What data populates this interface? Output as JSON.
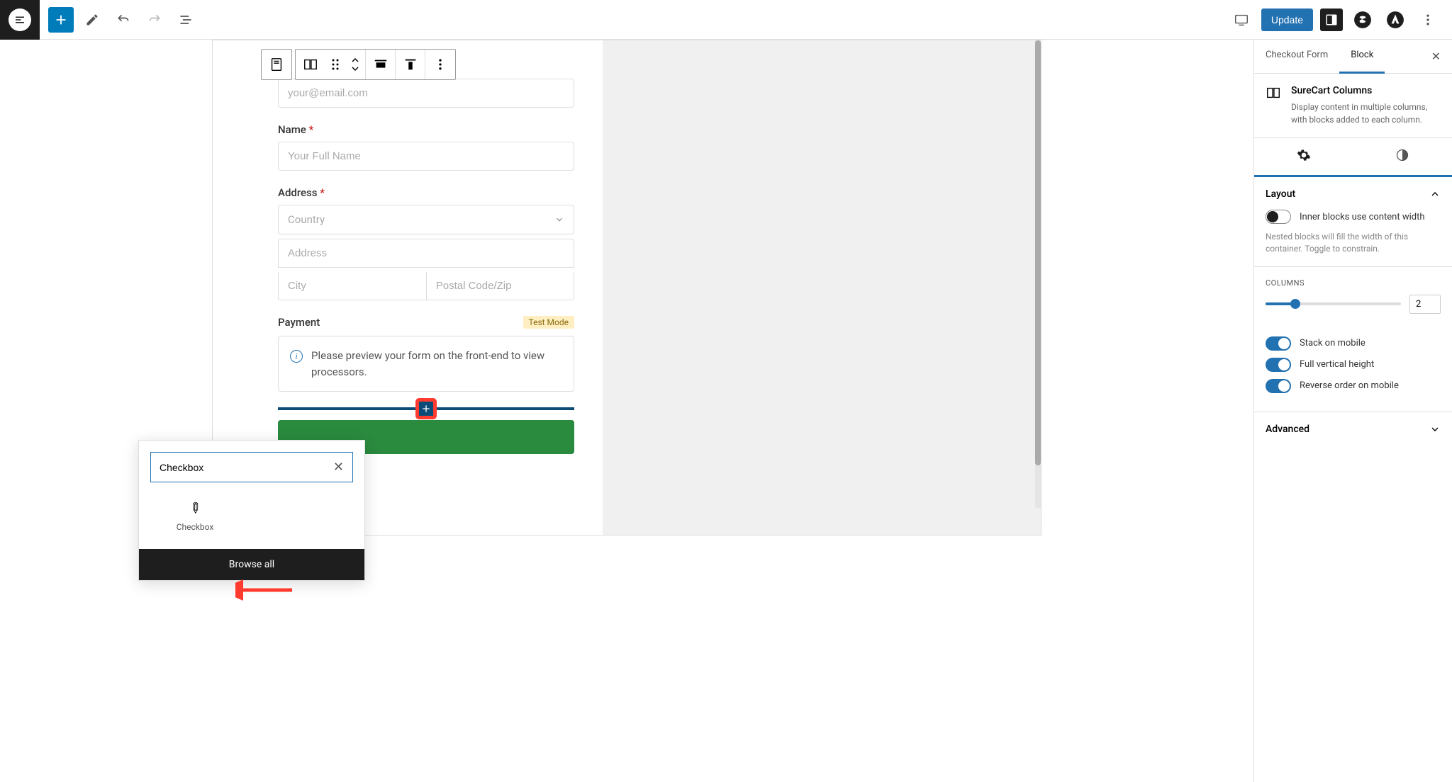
{
  "topbar": {
    "update_label": "Update"
  },
  "form": {
    "email_placeholder": "your@email.com",
    "name_label": "Name",
    "name_placeholder": "Your Full Name",
    "address_label": "Address",
    "country_placeholder": "Country",
    "address_placeholder": "Address",
    "city_placeholder": "City",
    "zip_placeholder": "Postal Code/Zip",
    "payment_label": "Payment",
    "test_mode": "Test Mode",
    "payment_info": "Please preview your form on the front-end to view processors."
  },
  "inserter": {
    "search_value": "Checkbox",
    "result_label": "Checkbox",
    "browse_all": "Browse all"
  },
  "sidebar": {
    "tab1": "Checkout Form",
    "tab2": "Block",
    "block_title": "SureCart Columns",
    "block_desc": "Display content in multiple columns, with blocks added to each column.",
    "layout_label": "Layout",
    "inner_width_label": "Inner blocks use content width",
    "inner_width_help": "Nested blocks will fill the width of this container. Toggle to constrain.",
    "columns_label": "COLUMNS",
    "columns_value": "2",
    "stack_label": "Stack on mobile",
    "full_height_label": "Full vertical height",
    "reverse_label": "Reverse order on mobile",
    "advanced_label": "Advanced"
  }
}
